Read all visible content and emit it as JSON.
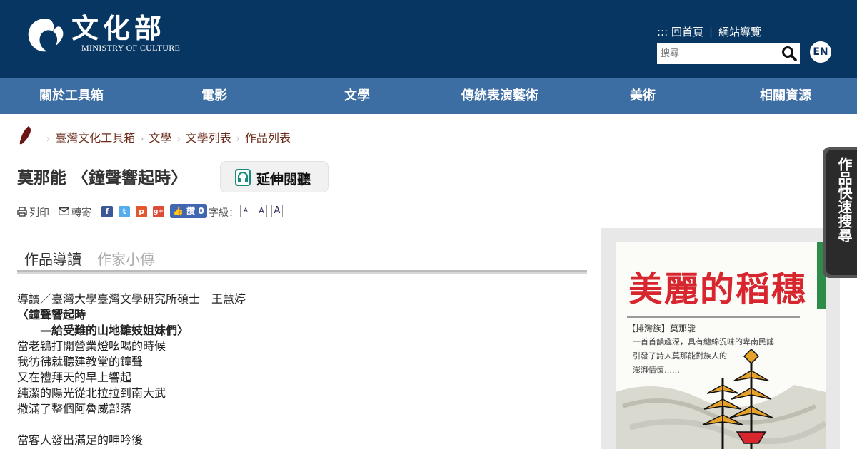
{
  "header": {
    "logo_cn": "文化部",
    "logo_en": "MINISTRY OF CULTURE",
    "toplinks": {
      "prefix": ":::",
      "home": "回首頁",
      "sitemap": "網站導覽"
    },
    "search": {
      "placeholder": "搜尋"
    },
    "lang_button": "EN"
  },
  "nav": {
    "items": [
      {
        "label": "關於工具箱"
      },
      {
        "label": "電影"
      },
      {
        "label": "文學"
      },
      {
        "label": "傳統表演藝術"
      },
      {
        "label": "美術"
      },
      {
        "label": "相關資源"
      }
    ]
  },
  "breadcrumb": {
    "items": [
      {
        "label": "臺灣文化工具箱"
      },
      {
        "label": "文學"
      },
      {
        "label": "文學列表"
      },
      {
        "label": "作品列表"
      }
    ]
  },
  "page": {
    "title": "莫那能 〈鐘聲響起時〉",
    "extended_button": "延伸閱聽"
  },
  "tools": {
    "print": "列印",
    "forward": "轉寄",
    "like_label": "讚 0",
    "fontsize_label": "字級：",
    "fontsize_options": [
      "A",
      "A",
      "A"
    ]
  },
  "tabs": [
    {
      "label": "作品導讀",
      "active": true
    },
    {
      "label": "作家小傳",
      "active": false
    }
  ],
  "article": {
    "lines": [
      {
        "text": "導讀／臺灣大學臺灣文學研究所碩士　王慧婷",
        "bold": false
      },
      {
        "text": "〈鐘聲響起時",
        "bold": true
      },
      {
        "text": "　　—給受難的山地雛妓姐妹們〉",
        "bold": true
      },
      {
        "text": "當老鴇打開營業燈吆喝的時候",
        "bold": false
      },
      {
        "text": "我彷彿就聽建教堂的鐘聲",
        "bold": false
      },
      {
        "text": "又在禮拜天的早上響起",
        "bold": false
      },
      {
        "text": "純潔的陽光從北拉拉到南大武",
        "bold": false
      },
      {
        "text": "撒滿了整個阿魯威部落",
        "bold": false
      },
      {
        "text": "",
        "bold": false
      },
      {
        "text": "當客人發出滿足的呻吟後",
        "bold": false
      }
    ]
  },
  "cover": {
    "title": "美麗的稻穗",
    "author": "【排灣族】莫那能",
    "blurb": "一首首韻趣深，具有纏綿況味的卑南民謠\n引發了詩人莫那能對族人的\n澎湃情懷……"
  },
  "quick_search": "作品快速搜尋",
  "colors": {
    "header_bg": "#073662",
    "nav_bg": "#3d6ea3",
    "breadcrumb_text": "#6b2a1a",
    "cover_title": "#d8262f"
  }
}
